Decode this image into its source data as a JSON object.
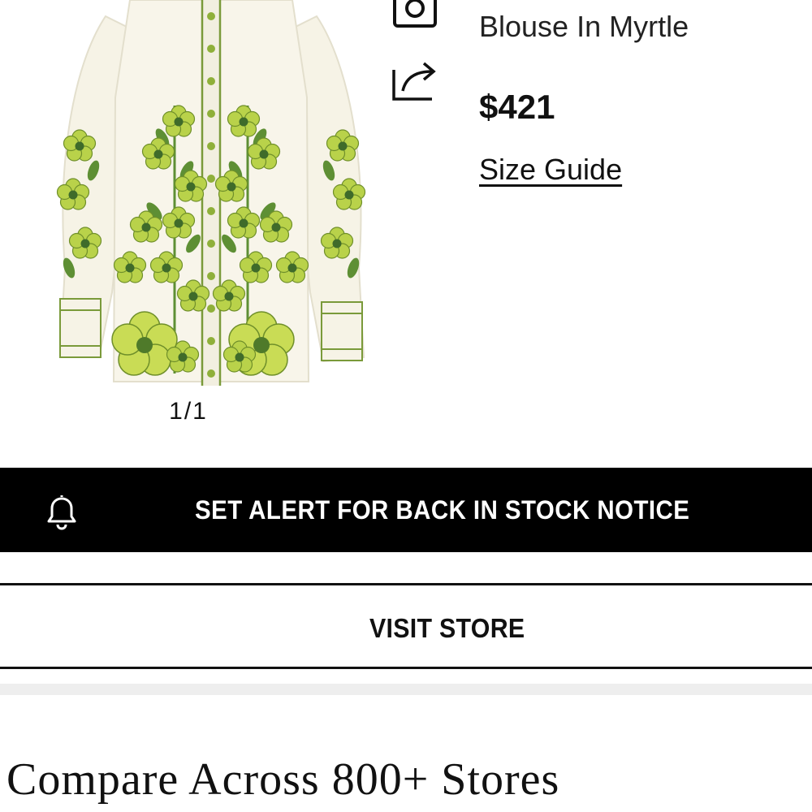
{
  "product": {
    "name": "Blouse In Myrtle",
    "price": "$421",
    "size_guide_label": "Size Guide",
    "image_icon": "floral-blouse-image",
    "image_counter": "1/1"
  },
  "actions": {
    "camera_icon": "camera-icon",
    "share_icon": "share-icon"
  },
  "buttons": {
    "alert_label": "SET ALERT FOR BACK IN STOCK NOTICE",
    "alert_icon": "bell-icon",
    "visit_store_label": "VISIT STORE"
  },
  "compare": {
    "heading": "Compare Across 800+ Stores"
  },
  "colors": {
    "primary": "#000000",
    "background": "#ffffff",
    "divider": "#eeeeee",
    "print_green": "#9cc23a",
    "print_dark_green": "#4f7a2a",
    "fabric": "#f7f4e8"
  }
}
